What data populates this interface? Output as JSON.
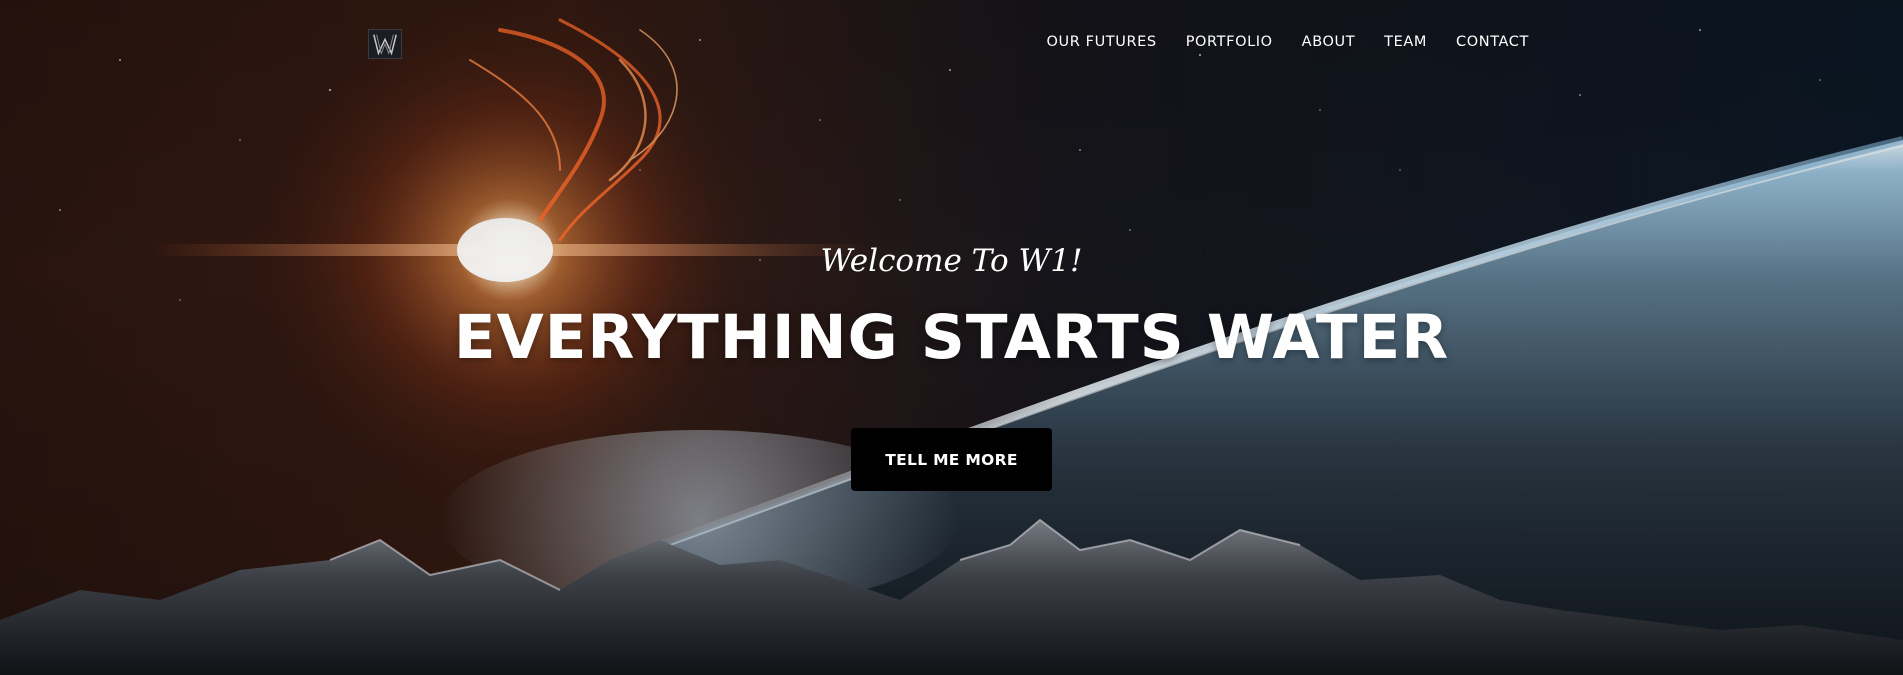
{
  "brand": {
    "logo_icon": "w-monogram-icon",
    "logo_letter": "W"
  },
  "nav": {
    "items": [
      {
        "label": "OUR FUTURES"
      },
      {
        "label": "PORTFOLIO"
      },
      {
        "label": "ABOUT"
      },
      {
        "label": "TEAM"
      },
      {
        "label": "CONTACT"
      }
    ]
  },
  "hero": {
    "lead": "Welcome To W1!",
    "heading": "EVERYTHING STARTS WATER",
    "cta_label": "TELL ME MORE",
    "background_icon": "space-planet-mountains-image"
  },
  "colors": {
    "text": "#ffffff",
    "cta_background": "#000000",
    "planet_glow": "#bfe0f5",
    "nebula": "#ff6a2b"
  }
}
